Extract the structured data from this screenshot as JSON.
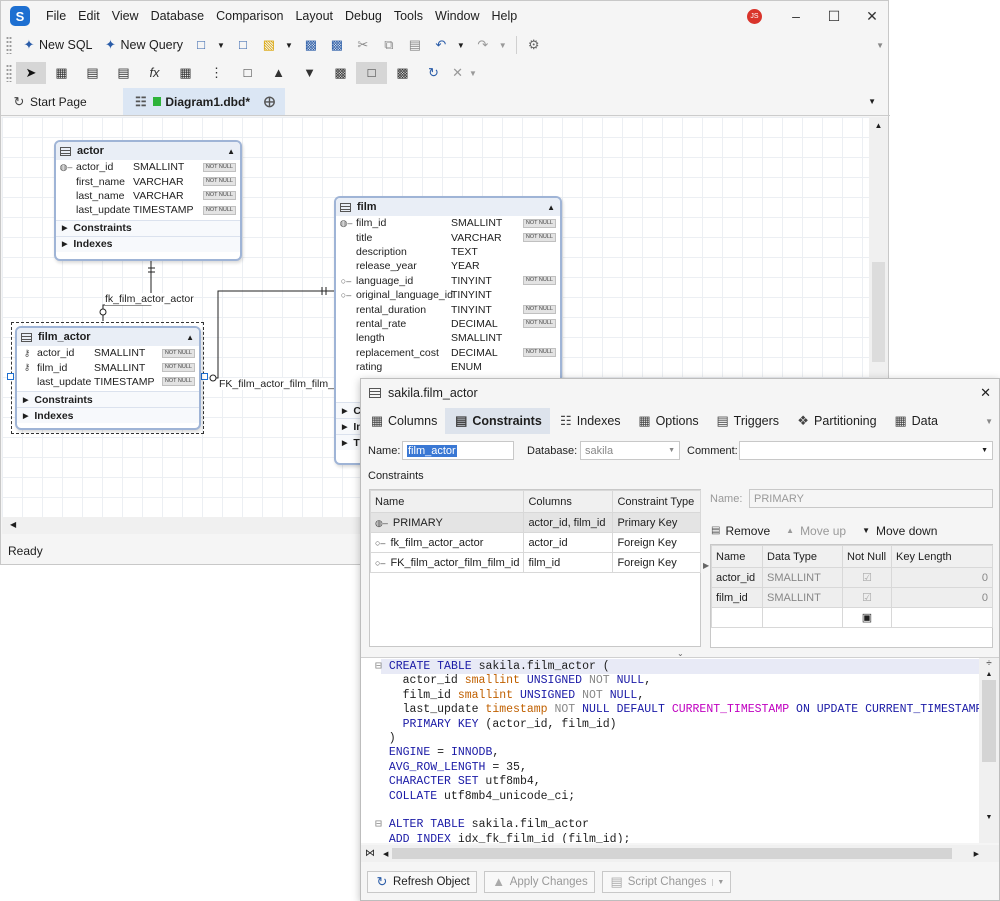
{
  "menu": {
    "items": [
      "File",
      "Edit",
      "View",
      "Database",
      "Comparison",
      "Layout",
      "Debug",
      "Tools",
      "Window",
      "Help"
    ],
    "avatar": "JS"
  },
  "toolbar": {
    "new_sql": "New SQL",
    "new_query": "New Query"
  },
  "tabs": {
    "start": "Start Page",
    "diagram": "Diagram1.dbd*"
  },
  "status": "Ready",
  "diagram": {
    "actor": {
      "name": "actor",
      "rows": [
        {
          "n": "actor_id",
          "t": "SMALLINT",
          "nn": "NOT NULL",
          "k": "pk"
        },
        {
          "n": "first_name",
          "t": "VARCHAR",
          "nn": "NOT NULL",
          "k": ""
        },
        {
          "n": "last_name",
          "t": "VARCHAR",
          "nn": "NOT NULL",
          "k": ""
        },
        {
          "n": "last_update",
          "t": "TIMESTAMP",
          "nn": "NOT NULL",
          "k": ""
        }
      ],
      "sub": [
        "Constraints",
        "Indexes"
      ]
    },
    "film": {
      "name": "film",
      "rows": [
        {
          "n": "film_id",
          "t": "SMALLINT",
          "nn": "NOT NULL",
          "k": "pk"
        },
        {
          "n": "title",
          "t": "VARCHAR",
          "nn": "NOT NULL",
          "k": ""
        },
        {
          "n": "description",
          "t": "TEXT",
          "nn": "",
          "k": ""
        },
        {
          "n": "release_year",
          "t": "YEAR",
          "nn": "",
          "k": ""
        },
        {
          "n": "language_id",
          "t": "TINYINT",
          "nn": "NOT NULL",
          "k": "fk"
        },
        {
          "n": "original_language_id",
          "t": "TINYINT",
          "nn": "",
          "k": "fk"
        },
        {
          "n": "rental_duration",
          "t": "TINYINT",
          "nn": "NOT NULL",
          "k": ""
        },
        {
          "n": "rental_rate",
          "t": "DECIMAL",
          "nn": "NOT NULL",
          "k": ""
        },
        {
          "n": "length",
          "t": "SMALLINT",
          "nn": "",
          "k": ""
        },
        {
          "n": "replacement_cost",
          "t": "DECIMAL",
          "nn": "NOT NULL",
          "k": ""
        },
        {
          "n": "rating",
          "t": "ENUM",
          "nn": "",
          "k": ""
        }
      ],
      "sub": [
        "C",
        "In",
        "T"
      ]
    },
    "film_actor": {
      "name": "film_actor",
      "rows": [
        {
          "n": "actor_id",
          "t": "SMALLINT",
          "nn": "NOT NULL",
          "k": "pfk"
        },
        {
          "n": "film_id",
          "t": "SMALLINT",
          "nn": "NOT NULL",
          "k": "pfk"
        },
        {
          "n": "last_update",
          "t": "TIMESTAMP",
          "nn": "NOT NULL",
          "k": ""
        }
      ],
      "sub": [
        "Constraints",
        "Indexes"
      ]
    },
    "rel1": "fk_film_actor_actor",
    "rel2": "FK_film_actor_film_film_id"
  },
  "editor": {
    "title": "sakila.film_actor",
    "tabs": [
      "Columns",
      "Constraints",
      "Indexes",
      "Options",
      "Triggers",
      "Partitioning",
      "Data"
    ],
    "name_label": "Name:",
    "name_value": "film_actor",
    "db_label": "Database:",
    "db_value": "sakila",
    "comment_label": "Comment:",
    "constraints_label": "Constraints",
    "constraints": {
      "headers": [
        "Name",
        "Columns",
        "Constraint Type"
      ],
      "rows": [
        {
          "name": "PRIMARY",
          "cols": "actor_id, film_id",
          "type": "Primary Key"
        },
        {
          "name": "fk_film_actor_actor",
          "cols": "actor_id",
          "type": "Foreign Key"
        },
        {
          "name": "FK_film_actor_film_film_id",
          "cols": "film_id",
          "type": "Foreign Key"
        }
      ]
    },
    "right_name_label": "Name:",
    "right_name_value": "PRIMARY",
    "right_buttons": [
      "Remove",
      "Move up",
      "Move down"
    ],
    "keycols": {
      "headers": [
        "Name",
        "Data Type",
        "Not Null",
        "Key Length"
      ],
      "rows": [
        {
          "name": "actor_id",
          "type": "SMALLINT",
          "len": "0"
        },
        {
          "name": "film_id",
          "type": "SMALLINT",
          "len": "0"
        }
      ]
    },
    "buttons": [
      "Refresh Object",
      "Apply Changes",
      "Script Changes"
    ]
  }
}
